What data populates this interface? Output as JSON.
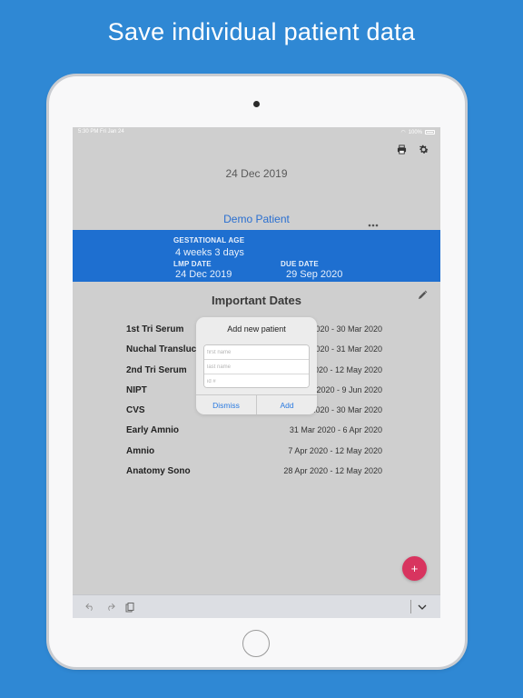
{
  "headline": "Save individual patient data",
  "status_bar": {
    "time": "5:30 PM  Fri Jan 24",
    "battery": "100%"
  },
  "toolbar": {
    "print_icon": "printer-icon",
    "settings_icon": "gear-icon"
  },
  "date_title": "24 Dec 2019",
  "patient": {
    "name": "Demo Patient",
    "more_icon": "ellipsis-icon"
  },
  "summary": {
    "gestational_age_label": "GESTATIONAL AGE",
    "gestational_age_value": "4 weeks  3 days",
    "lmp_label": "LMP DATE",
    "lmp_value": "24 Dec 2019",
    "due_label": "DUE DATE",
    "due_value": "29 Sep 2020"
  },
  "important_dates": {
    "title": "Important Dates",
    "edit_icon": "pencil-icon",
    "items": [
      {
        "name": "1st Tri Serum",
        "range": "2020 - 30 Mar 2020"
      },
      {
        "name": "Nuchal Transluce",
        "range": "2020 - 31 Mar 2020"
      },
      {
        "name": "2nd Tri Serum",
        "range": "2020 - 12 May 2020"
      },
      {
        "name": "NIPT",
        "range": "2020 - 9 Jun 2020"
      },
      {
        "name": "CVS",
        "range": "3 Mar 2020 - 30 Mar 2020"
      },
      {
        "name": "Early Amnio",
        "range": "31 Mar 2020 - 6 Apr 2020"
      },
      {
        "name": "Amnio",
        "range": "7 Apr 2020 - 12 May 2020"
      },
      {
        "name": "Anatomy Sono",
        "range": "28 Apr 2020 - 12 May 2020"
      }
    ]
  },
  "dialog": {
    "title": "Add new patient",
    "first_name_placeholder": "first name",
    "last_name_placeholder": "last name",
    "id_placeholder": "id #",
    "dismiss_label": "Dismiss",
    "add_label": "Add"
  },
  "fab": {
    "label": "+"
  },
  "bottom_bar": {
    "undo_icon": "undo-icon",
    "redo_icon": "redo-icon",
    "paste_icon": "clipboard-icon",
    "collapse_icon": "chevron-down-icon"
  },
  "colors": {
    "background": "#2f88d4",
    "band": "#1e6fd0",
    "accent": "#2a6fd0",
    "fab": "#d8345f"
  }
}
